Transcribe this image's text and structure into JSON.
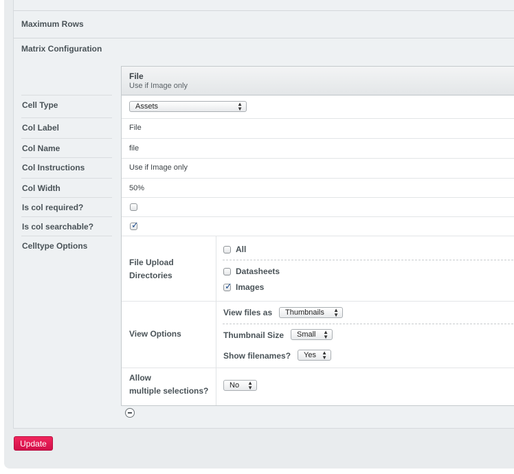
{
  "sections": {
    "maximum_rows": "Maximum Rows",
    "matrix_configuration": "Matrix Configuration"
  },
  "labels": {
    "cell_type": "Cell Type",
    "col_label": "Col Label",
    "col_name": "Col Name",
    "col_instructions": "Col Instructions",
    "col_width": "Col Width",
    "is_col_required": "Is col required?",
    "is_col_searchable": "Is col searchable?",
    "celltype_options": "Celltype Options"
  },
  "column": {
    "header_title": "File",
    "header_subtitle": "Use if Image only",
    "cell_type_value": "Assets",
    "col_label_value": "File",
    "col_name_value": "file",
    "col_instructions_value": "Use if Image only",
    "col_width_value": "50%",
    "is_required": false,
    "is_searchable": true
  },
  "celltype_options": {
    "file_upload_label_line1": "File Upload",
    "file_upload_label_line2": "Directories",
    "directories": [
      {
        "label": "All",
        "checked": false
      },
      {
        "label": "Datasheets",
        "checked": false
      },
      {
        "label": "Images",
        "checked": true
      }
    ],
    "view_options_label": "View Options",
    "view_files_as_label": "View files as",
    "view_files_as_value": "Thumbnails",
    "thumbnail_size_label": "Thumbnail Size",
    "thumbnail_size_value": "Small",
    "show_filenames_label": "Show filenames?",
    "show_filenames_value": "Yes",
    "allow_multiple_line1": "Allow",
    "allow_multiple_line2": "multiple selections?",
    "allow_multiple_value": "No"
  },
  "buttons": {
    "update": "Update"
  },
  "colors": {
    "accent": "#e0174f",
    "panel_bg": "#e9ecee",
    "checkmark": "#1d4d8c"
  }
}
